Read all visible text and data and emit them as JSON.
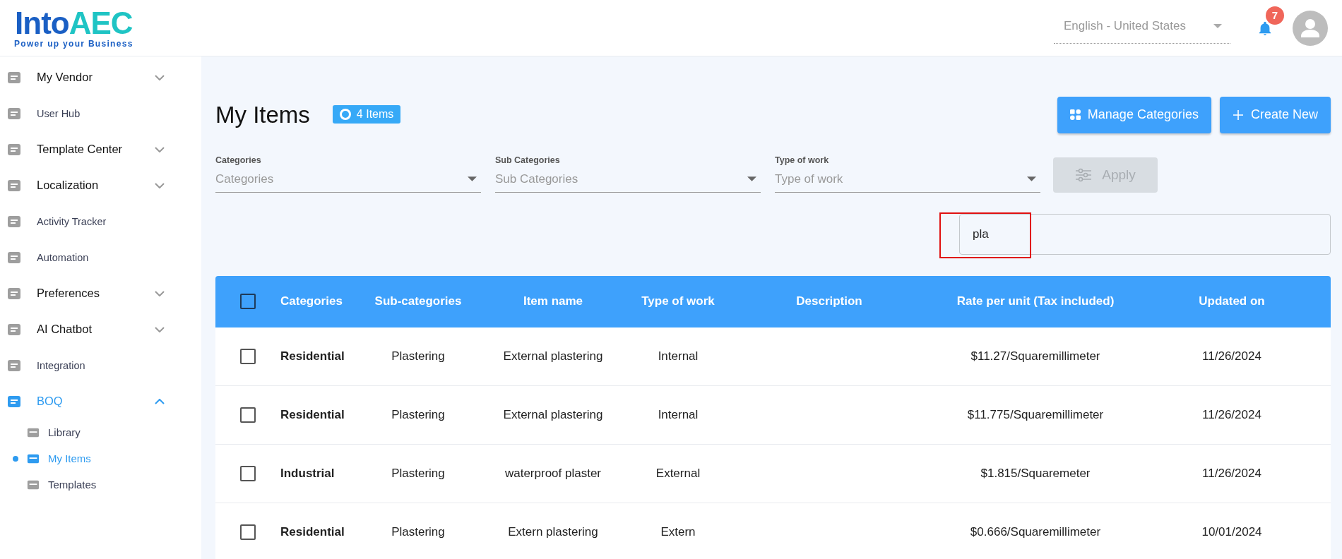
{
  "header": {
    "logo": {
      "part1": "Into",
      "part2": "AEC",
      "tagline": "Power up your Business"
    },
    "language": {
      "value": "English - United States"
    },
    "notifications": {
      "count": "7"
    }
  },
  "sidebar": {
    "items": [
      {
        "label": "My Vendor",
        "expandable": true,
        "expanded": false,
        "selected": false
      },
      {
        "label": "User Hub",
        "expandable": false,
        "selected": false
      },
      {
        "label": "Template Center",
        "expandable": true,
        "expanded": false,
        "selected": false
      },
      {
        "label": "Localization",
        "expandable": true,
        "expanded": false,
        "selected": false
      },
      {
        "label": "Activity Tracker",
        "expandable": false,
        "selected": false
      },
      {
        "label": "Automation",
        "expandable": false,
        "selected": false
      },
      {
        "label": "Preferences",
        "expandable": true,
        "expanded": false,
        "selected": false
      },
      {
        "label": "AI Chatbot",
        "expandable": true,
        "expanded": false,
        "selected": false
      },
      {
        "label": "Integration",
        "expandable": false,
        "selected": false
      },
      {
        "label": "BOQ",
        "expandable": true,
        "expanded": true,
        "selected": true,
        "children": [
          {
            "label": "Library",
            "selected": false
          },
          {
            "label": "My Items",
            "selected": true
          },
          {
            "label": "Templates",
            "selected": false
          }
        ]
      }
    ]
  },
  "page": {
    "title": "My Items",
    "count_badge": "4 Items",
    "buttons": [
      "Manage Categories",
      "Create New"
    ]
  },
  "filters": [
    {
      "label": "Categories",
      "placeholder": "Categories"
    },
    {
      "label": "Sub Categories",
      "placeholder": "Sub Categories"
    },
    {
      "label": "Type of work",
      "placeholder": "Type of work"
    }
  ],
  "apply_button": {
    "label": "Apply",
    "disabled": true
  },
  "search": {
    "value": "pla"
  },
  "table": {
    "select_all": {
      "checked": false
    },
    "columns": [
      "Categories",
      "Sub-categories",
      "Item name",
      "Type of work",
      "Description",
      "Rate per unit (Tax included)",
      "Updated on"
    ],
    "rows": [
      {
        "selected": false,
        "cells": [
          "Residential",
          "Plastering",
          "External plastering",
          "Internal",
          "",
          "$11.27/Squaremillimeter",
          "11/26/2024"
        ]
      },
      {
        "selected": false,
        "cells": [
          "Residential",
          "Plastering",
          "External plastering",
          "Internal",
          "",
          "$11.775/Squaremillimeter",
          "11/26/2024"
        ]
      },
      {
        "selected": false,
        "cells": [
          "Industrial",
          "Plastering",
          "waterproof plaster",
          "External",
          "",
          "$1.815/Squaremeter",
          "11/26/2024"
        ]
      },
      {
        "selected": false,
        "cells": [
          "Residential",
          "Plastering",
          "Extern plastering",
          "Extern",
          "",
          "$0.666/Squaremillimeter",
          "10/01/2024"
        ]
      }
    ]
  }
}
